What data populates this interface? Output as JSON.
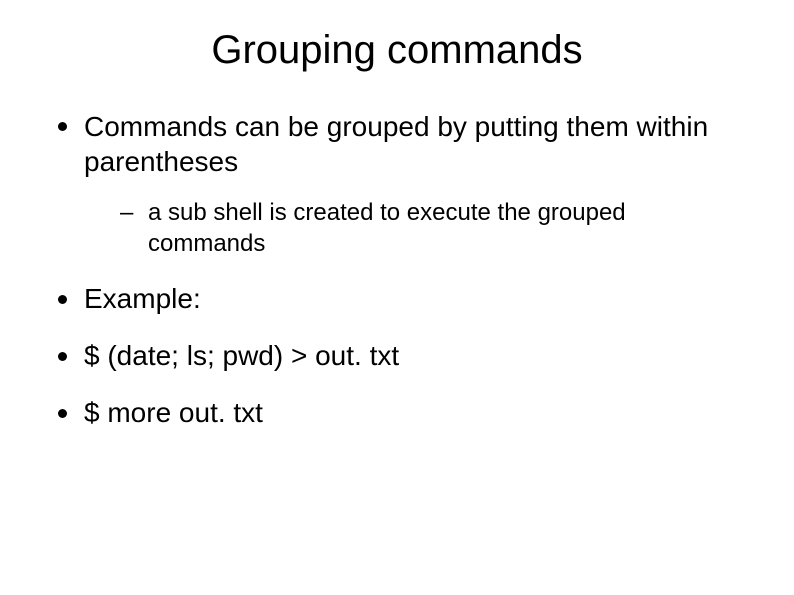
{
  "title": "Grouping commands",
  "bullets": {
    "b1": "Commands can be grouped by putting them within parentheses",
    "b1_sub": "a sub shell is created to execute the grouped commands",
    "b2": "Example:",
    "b3": "$ (date; ls; pwd) > out. txt",
    "b4": "$ more out. txt"
  }
}
